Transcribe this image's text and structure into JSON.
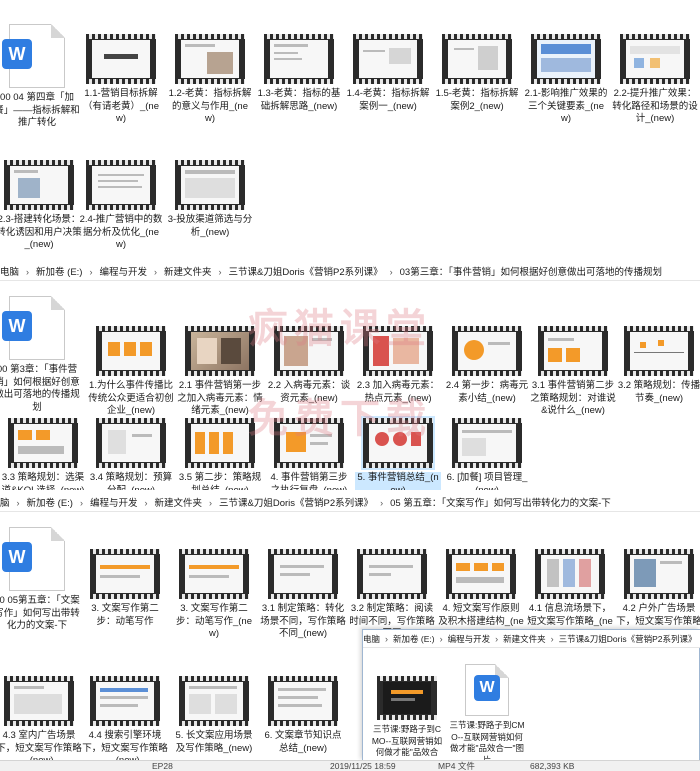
{
  "section1": {
    "items": [
      {
        "label": "00 04 第四章「加餐」——指标拆解和推广转化",
        "type": "doc"
      },
      {
        "label": "1.1-营销目标拆解（有请老黄）_(new)",
        "type": "video"
      },
      {
        "label": "1.2-老黄：指标拆解的意义与作用_(new)",
        "type": "video"
      },
      {
        "label": "1.3-老黄：指标的基础拆解思路_(new)",
        "type": "video"
      },
      {
        "label": "1.4-老黄：指标拆解案例一_(new)",
        "type": "video"
      },
      {
        "label": "1.5-老黄：指标拆解案例2_(new)",
        "type": "video"
      },
      {
        "label": "2.1-影响推广效果的三个关键要素_(new)",
        "type": "video"
      },
      {
        "label": "2.2-提升推广效果：转化路径和场景的设计_(new)",
        "type": "video"
      },
      {
        "label": "2.3-搭建转化场景：转化诱因和用户决策_(new)",
        "type": "video"
      },
      {
        "label": "2.4-推广营销中的数据分析及优化_(new)",
        "type": "video"
      },
      {
        "label": "3-投放渠道筛选与分析_(new)",
        "type": "video"
      }
    ]
  },
  "section2": {
    "breadcrumb": [
      "电脑",
      "新加卷 (E:)",
      "编程与开发",
      "新建文件夹",
      "三节课&刀姐Doris《营销P2系列课》",
      "03第三章：「事件营销」如何根据好创意做出可落地的传播规划"
    ],
    "items": [
      {
        "label": "00 第3章：「事件营销」如何根据好创意做出可落地的传播规划",
        "type": "doc"
      },
      {
        "label": "1.为什么事件传播比传统公众更适合初创企业_(new)",
        "type": "video"
      },
      {
        "label": "2.1 事件营销第一步之加入病毒元素：情绪元素_(new)",
        "type": "video"
      },
      {
        "label": "2.2 入病毒元素：谈资元素_(new)",
        "type": "video"
      },
      {
        "label": "2.3 加入病毒元素：热点元素_(new)",
        "type": "video"
      },
      {
        "label": "2.4 第一步：病毒元素小结_(new)",
        "type": "video"
      },
      {
        "label": "3.1 事件营销第二步之策略规划：对谁说&说什么_(new)",
        "type": "video"
      },
      {
        "label": "3.2 策略规划：传播节奏_(new)",
        "type": "video"
      },
      {
        "label": "3.3 策略规划：选渠道&KOL选择_(new)",
        "type": "video"
      },
      {
        "label": "3.4 策略规划：预算分配_(new)",
        "type": "video"
      },
      {
        "label": "3.5 第二步：策略规划总结_(new)",
        "type": "video"
      },
      {
        "label": "4. 事件营销第三步之执行复盘_(new)",
        "type": "video"
      },
      {
        "label": "5. 事件营销总结_(new)",
        "type": "video",
        "selected": true
      },
      {
        "label": "6. [加餐] 项目管理_(new)",
        "type": "video"
      }
    ]
  },
  "section3": {
    "breadcrumb": [
      "脑",
      "新加卷 (E:)",
      "编程与开发",
      "新建文件夹",
      "三节课&刀姐Doris《营销P2系列课》",
      "05 第五章：「文案写作」如何写出带转化力的文案-下"
    ],
    "items": [
      {
        "label": "00 05第五章：「文案写作」如何写出带转化力的文案-下",
        "type": "doc"
      },
      {
        "label": "3. 文案写作第二步：动笔写作",
        "type": "video"
      },
      {
        "label": "3. 文案写作第二步：动笔写作_(new)",
        "type": "video"
      },
      {
        "label": "3.1 制定策略：转化场景不同，写作策略不同_(new)",
        "type": "video"
      },
      {
        "label": "3.2 制定策略：阅读时间不同，写作策略不同",
        "type": "video"
      },
      {
        "label": "4. 短文案写作原则及积木搭建结构_(new)",
        "type": "video"
      },
      {
        "label": "4.1 信息流场景下，短文案写作策略_(new)",
        "type": "video"
      },
      {
        "label": "4.2 户外广告场景下，短文案写作策略_(new)",
        "type": "video"
      },
      {
        "label": "4.3 室内广告场景下，短文案写作策略_(new)",
        "type": "video"
      },
      {
        "label": "4.4 搜索引擎环境下，短文案写作策略_(new)",
        "type": "video"
      },
      {
        "label": "5. 长文案应用场景及写作策略_(new)",
        "type": "video"
      },
      {
        "label": "6. 文案章节知识点总结_(new)",
        "type": "video"
      }
    ]
  },
  "popup": {
    "breadcrumb": [
      "电脑",
      "新加卷 (E:)",
      "编程与开发",
      "新建文件夹",
      "三节课&刀姐Doris《营销P2系列课》"
    ],
    "items": [
      {
        "label": "三节课:野路子到CMO--互联网营销如何做才能\"品效合一\"(new)",
        "type": "video"
      },
      {
        "label": "三节课:野路子到CMO--互联网营销如何做才能\"品效合一\"图片",
        "type": "doc"
      }
    ]
  },
  "watermark": {
    "line1": "疯猫课堂",
    "line2": "免费下载"
  },
  "status": {
    "a": "EP28",
    "b": "2019/11/25 18:59",
    "c": "MP4 文件",
    "d": "682,393 KB"
  },
  "colors": {
    "accent": "#2f7de1",
    "selection": "#cce8ff",
    "watermark": "#dc7882"
  }
}
